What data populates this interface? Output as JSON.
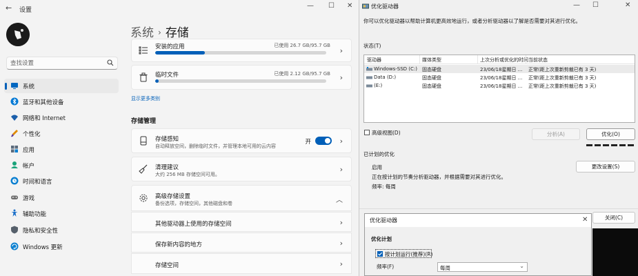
{
  "settings": {
    "window_title": "设置",
    "search_placeholder": "查找设置",
    "nav": [
      {
        "label": "系统",
        "icon": "system-icon",
        "color": "#0067c0"
      },
      {
        "label": "蓝牙和其他设备",
        "icon": "bluetooth-icon",
        "color": "#0078d4"
      },
      {
        "label": "网络和 Internet",
        "icon": "wifi-icon",
        "color": "#1b5fab"
      },
      {
        "label": "个性化",
        "icon": "brush-icon",
        "color": "#e08a00"
      },
      {
        "label": "应用",
        "icon": "apps-icon",
        "color": "#5b6b7c"
      },
      {
        "label": "帐户",
        "icon": "account-icon",
        "color": "#1aa37a"
      },
      {
        "label": "时间和语言",
        "icon": "globe-time-icon",
        "color": "#0a7fd0"
      },
      {
        "label": "游戏",
        "icon": "game-controller-icon",
        "color": "#6b6b6b"
      },
      {
        "label": "辅助功能",
        "icon": "accessibility-icon",
        "color": "#1a6fc9"
      },
      {
        "label": "隐私和安全性",
        "icon": "shield-icon",
        "color": "#56606b"
      },
      {
        "label": "Windows 更新",
        "icon": "update-icon",
        "color": "#0a7fd0"
      }
    ],
    "breadcrumb": {
      "parent": "系统",
      "current": "存储"
    },
    "storage_items": [
      {
        "title": "安装的应用",
        "size": "已使用 26.7 GB/95.7 GB",
        "progress": 0.29
      },
      {
        "title": "临时文件",
        "size": "已使用 2.12 GB/95.7 GB",
        "progress": 0.02
      }
    ],
    "show_more": "显示更多类别",
    "storage_management": "存储管理",
    "storage_sense": {
      "title": "存储感知",
      "desc": "自动释放空间，删除临时文件，并管理本地可用的云内容",
      "toggle_label": "开",
      "on": true
    },
    "cleanup": {
      "title": "清理建议",
      "desc": "大约 256 MB 存储空间可用。"
    },
    "advanced": {
      "title": "高级存储设置",
      "desc": "备份选项，存储空间，其他磁盘和卷"
    },
    "advanced_items": [
      "其他驱动器上使用的存储空间",
      "保存新内容的地方",
      "存储空间"
    ]
  },
  "optimize": {
    "window_title": "优化驱动器",
    "description": "你可以优化驱动器以帮助计算机更高效地运行，或者分析驱动器以了解是否需要对其进行优化。",
    "status_label": "状态(T)",
    "columns": [
      "驱动器",
      "媒体类型",
      "上次分析或优化的时间",
      "当前状态"
    ],
    "drives": [
      {
        "name": "Windows-SSD (C:)",
        "media": "固态硬盘",
        "last": "23/06/18星期日 ...",
        "status": "正常(距上次重新剪裁已有 3 天)"
      },
      {
        "name": "Data (D:)",
        "media": "固态硬盘",
        "last": "23/06/18星期日 ...",
        "status": "正常(距上次重新剪裁已有 3 天)"
      },
      {
        "name": "(E:)",
        "media": "固态硬盘",
        "last": "23/06/18星期日 ...",
        "status": "正常(距上次重新剪裁已有 3 天)"
      }
    ],
    "advanced_view": "高级视图(D)",
    "analyze_button": "分析(A)",
    "optimize_button": "优化(O)",
    "scheduled_label": "已计划的优化",
    "enabled": "启用",
    "schedule_desc": "正在按计划的节奏分析驱动器，并根据需要对其进行优化。",
    "frequency_label": "频率: 每周",
    "change_settings": "更改设置(S)",
    "close_button": "关闭(C)"
  },
  "dialog": {
    "title": "优化驱动器",
    "schedule_heading": "优化计划",
    "run_schedule": "按计划运行(推荐)(R)",
    "frequency_label": "频率(F)",
    "frequency_value": "每周"
  },
  "colors": {
    "accent": "#005fb8"
  }
}
